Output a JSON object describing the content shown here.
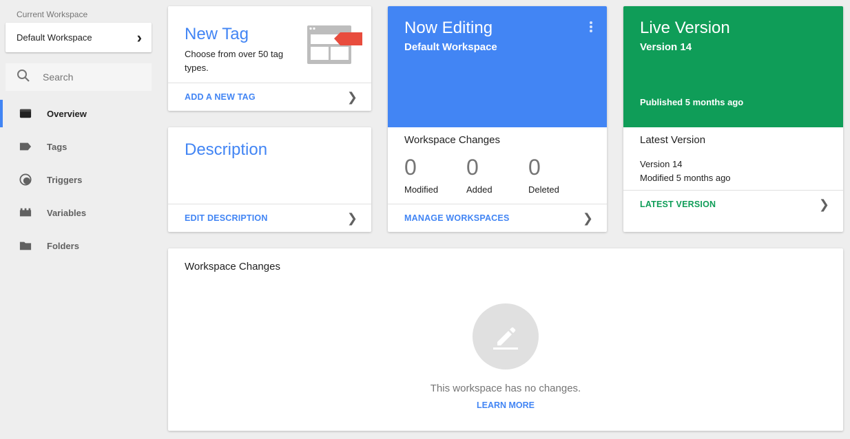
{
  "sidebar": {
    "workspace_caption": "Current Workspace",
    "workspace_name": "Default Workspace",
    "search_placeholder": "Search",
    "items": [
      {
        "label": "Overview",
        "icon": "overview-icon",
        "active": true
      },
      {
        "label": "Tags",
        "icon": "tag-icon"
      },
      {
        "label": "Triggers",
        "icon": "trigger-icon"
      },
      {
        "label": "Variables",
        "icon": "variables-icon"
      },
      {
        "label": "Folders",
        "icon": "folder-icon"
      }
    ]
  },
  "new_tag": {
    "title": "New Tag",
    "description": "Choose from over 50 tag types.",
    "action": "ADD A NEW TAG"
  },
  "description_card": {
    "title": "Description",
    "action": "EDIT DESCRIPTION"
  },
  "editing": {
    "title": "Now Editing",
    "workspace": "Default Workspace",
    "changes_heading": "Workspace Changes",
    "stats": [
      {
        "value": "0",
        "label": "Modified"
      },
      {
        "value": "0",
        "label": "Added"
      },
      {
        "value": "0",
        "label": "Deleted"
      }
    ],
    "action": "MANAGE WORKSPACES",
    "color": "#4285f4"
  },
  "live": {
    "title": "Live Version",
    "version": "Version 14",
    "published": "Published 5 months ago",
    "latest_heading": "Latest Version",
    "latest_version": "Version 14",
    "latest_modified": "Modified 5 months ago",
    "action": "LATEST VERSION",
    "color": "#0f9d58"
  },
  "workspace_changes": {
    "heading": "Workspace Changes",
    "empty_message": "This workspace has no changes.",
    "learn_more": "LEARN MORE",
    "icon": "edit-icon"
  }
}
